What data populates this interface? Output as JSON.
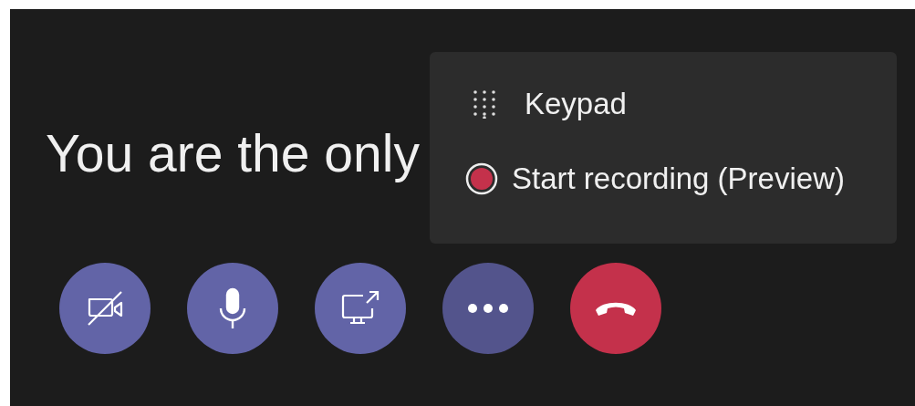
{
  "message": "You are the only",
  "menu": {
    "items": [
      {
        "kind": "keypad",
        "label": "Keypad"
      },
      {
        "kind": "record",
        "label": "Start recording (Preview)"
      }
    ]
  },
  "controls": [
    {
      "kind": "camera-off",
      "expanded": false
    },
    {
      "kind": "mic",
      "expanded": false
    },
    {
      "kind": "share",
      "expanded": false
    },
    {
      "kind": "more",
      "expanded": true
    },
    {
      "kind": "hangup",
      "expanded": false
    }
  ]
}
